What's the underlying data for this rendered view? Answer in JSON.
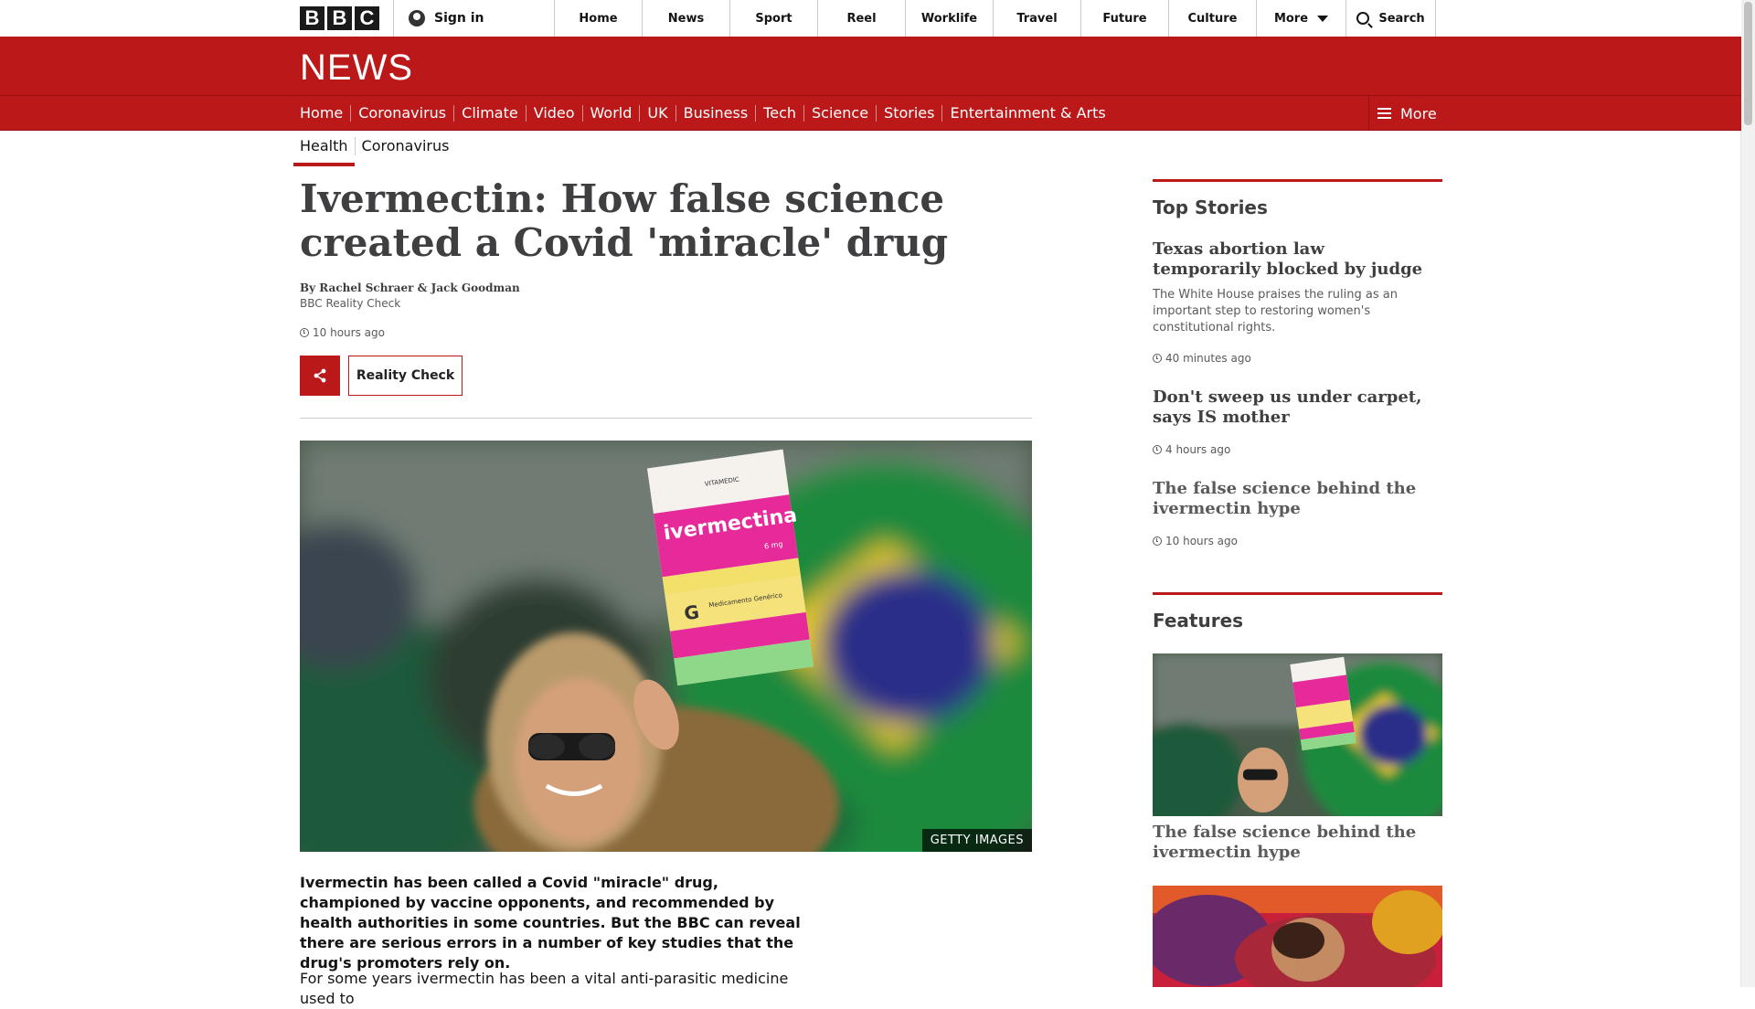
{
  "bbc_bar": {
    "logo_letters": [
      "B",
      "B",
      "C"
    ],
    "sign_in": "Sign in",
    "nav": [
      "Home",
      "News",
      "Sport",
      "Reel",
      "Worklife",
      "Travel",
      "Future",
      "Culture"
    ],
    "more": "More",
    "search": "Search"
  },
  "news_header": {
    "logo": "NEWS",
    "sections": [
      "Home",
      "Coronavirus",
      "Climate",
      "Video",
      "World",
      "UK",
      "Business",
      "Tech",
      "Science",
      "Stories",
      "Entertainment & Arts"
    ],
    "more": "More"
  },
  "subnav": {
    "tabs": [
      "Health",
      "Coronavirus"
    ],
    "active": "Health"
  },
  "article": {
    "headline": "Ivermectin: How false science created a Covid 'miracle' drug",
    "byline": "By Rachel Schraer & Jack Goodman",
    "byline_sub": "BBC Reality Check",
    "timestamp": "10 hours ago",
    "topic_button": "Reality Check",
    "image_credit": "GETTY IMAGES",
    "intro": "Ivermectin has been called a Covid \"miracle\" drug, championed by vaccine opponents, and recommended by health authorities in some countries. But the BBC can reveal there are serious errors in a number of key studies that the drug's promoters rely on.",
    "paragraph_1": "For some years ivermectin has been a vital anti-parasitic medicine used to",
    "image_sign": {
      "brand": "VITAMEDIC",
      "name": "ivermectina",
      "dose": "6 mg",
      "generic_letter": "G",
      "generic_label": "Medicamento Genérico"
    }
  },
  "sidebar": {
    "top_stories_heading": "Top Stories",
    "top_stories": [
      {
        "title": "Texas abortion law temporarily blocked by judge",
        "summary": "The White House praises the ruling as an important step to restoring women's constitutional rights.",
        "time": "40 minutes ago"
      },
      {
        "title": "Don't sweep us under carpet, says IS mother",
        "time": "4 hours ago"
      },
      {
        "title": "The false science behind the ivermectin hype",
        "time": "10 hours ago"
      }
    ],
    "features_heading": "Features",
    "features": [
      {
        "title": "The false science behind the ivermectin hype"
      }
    ]
  },
  "colors": {
    "brand_red": "#bb1919",
    "text_dark": "#3f3f42",
    "text_muted": "#5a5a5a"
  }
}
